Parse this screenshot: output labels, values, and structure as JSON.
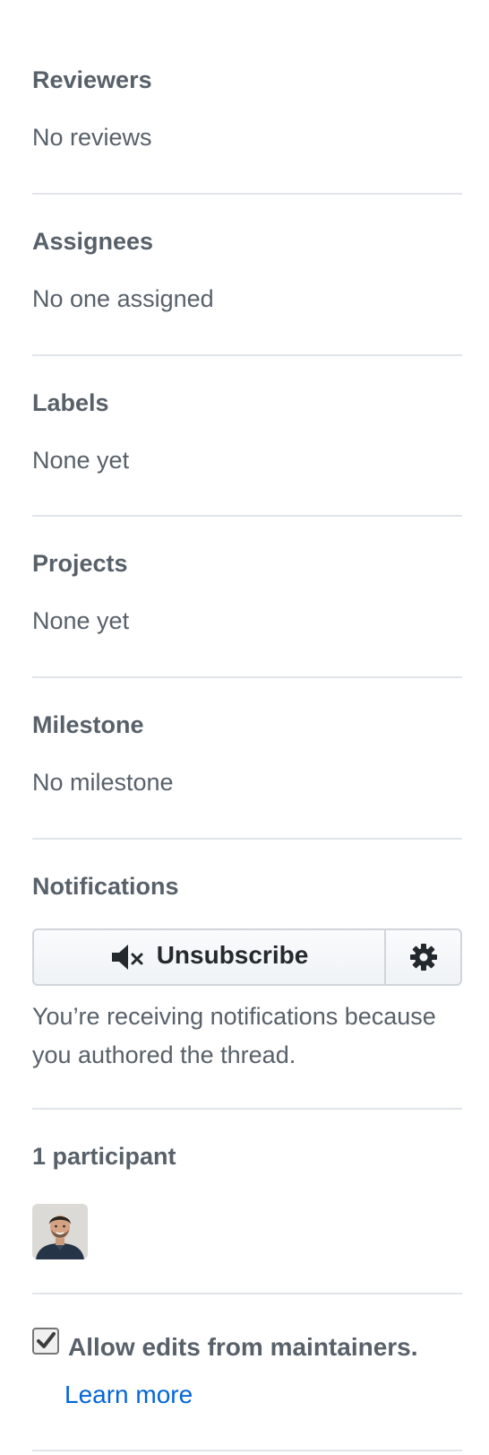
{
  "sidebar": {
    "reviewers": {
      "heading": "Reviewers",
      "value": "No reviews"
    },
    "assignees": {
      "heading": "Assignees",
      "value": "No one assigned"
    },
    "labels": {
      "heading": "Labels",
      "value": "None yet"
    },
    "projects": {
      "heading": "Projects",
      "value": "None yet"
    },
    "milestone": {
      "heading": "Milestone",
      "value": "No milestone"
    },
    "notifications": {
      "heading": "Notifications",
      "button_label": "Unsubscribe",
      "button_icon": "mute-icon",
      "settings_icon": "gear-icon",
      "reason": "You’re receiving notifications because you authored the thread."
    },
    "participants": {
      "heading": "1 participant",
      "avatar_icon": "avatar"
    },
    "maintainer_edits": {
      "checked": true,
      "label": "Allow edits from maintainers.",
      "link": "Learn more"
    }
  },
  "colors": {
    "text": "#586069",
    "heading": "#586069",
    "divider": "#e1e4e8",
    "link": "#0366d6",
    "button_text": "#24292e",
    "button_border": "#d1d5da"
  }
}
